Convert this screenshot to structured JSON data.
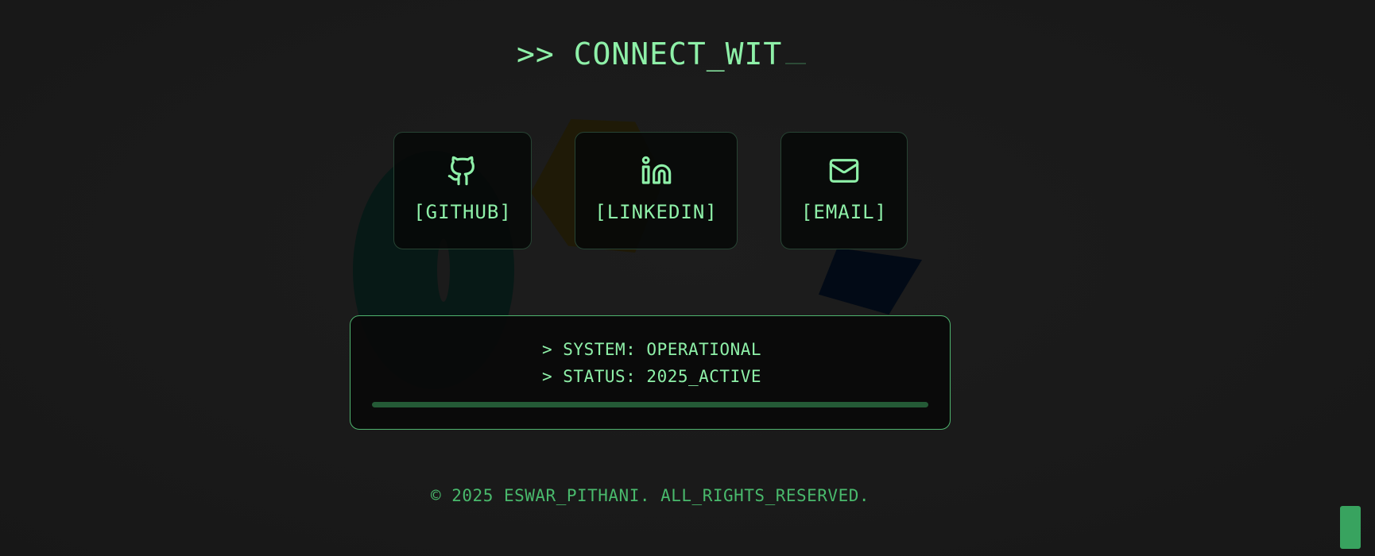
{
  "header": {
    "title": ">> CONNECT_WIT"
  },
  "links": [
    {
      "label": "[GITHUB]",
      "icon": "github-icon"
    },
    {
      "label": "[LINKEDIN]",
      "icon": "linkedin-icon"
    },
    {
      "label": "[EMAIL]",
      "icon": "mail-icon"
    }
  ],
  "status": {
    "line1": "> SYSTEM: OPERATIONAL",
    "line2": "> STATUS: 2025_ACTIVE",
    "progress": 1.0
  },
  "footer": {
    "copyright": "© 2025 ESWAR_PITHANI. ALL_RIGHTS_RESERVED."
  },
  "colors": {
    "background": "#1a1a1a",
    "accent": "#8ef0a8",
    "border": "#4fb36e",
    "footer_text": "#49b96c",
    "button": "#38a35f"
  }
}
